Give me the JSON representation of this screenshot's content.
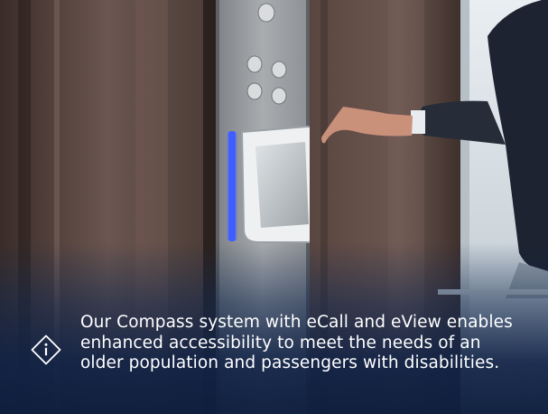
{
  "scene": {
    "description_icon": "info-diamond-icon",
    "accent_color": "#3f6bff",
    "overlay_color": "#12284e"
  },
  "caption": {
    "lines": [
      "Our Compass system with eCall and eView enables",
      "enhanced accessibility to meet the needs of an",
      "older population and passengers with disabilities."
    ]
  }
}
